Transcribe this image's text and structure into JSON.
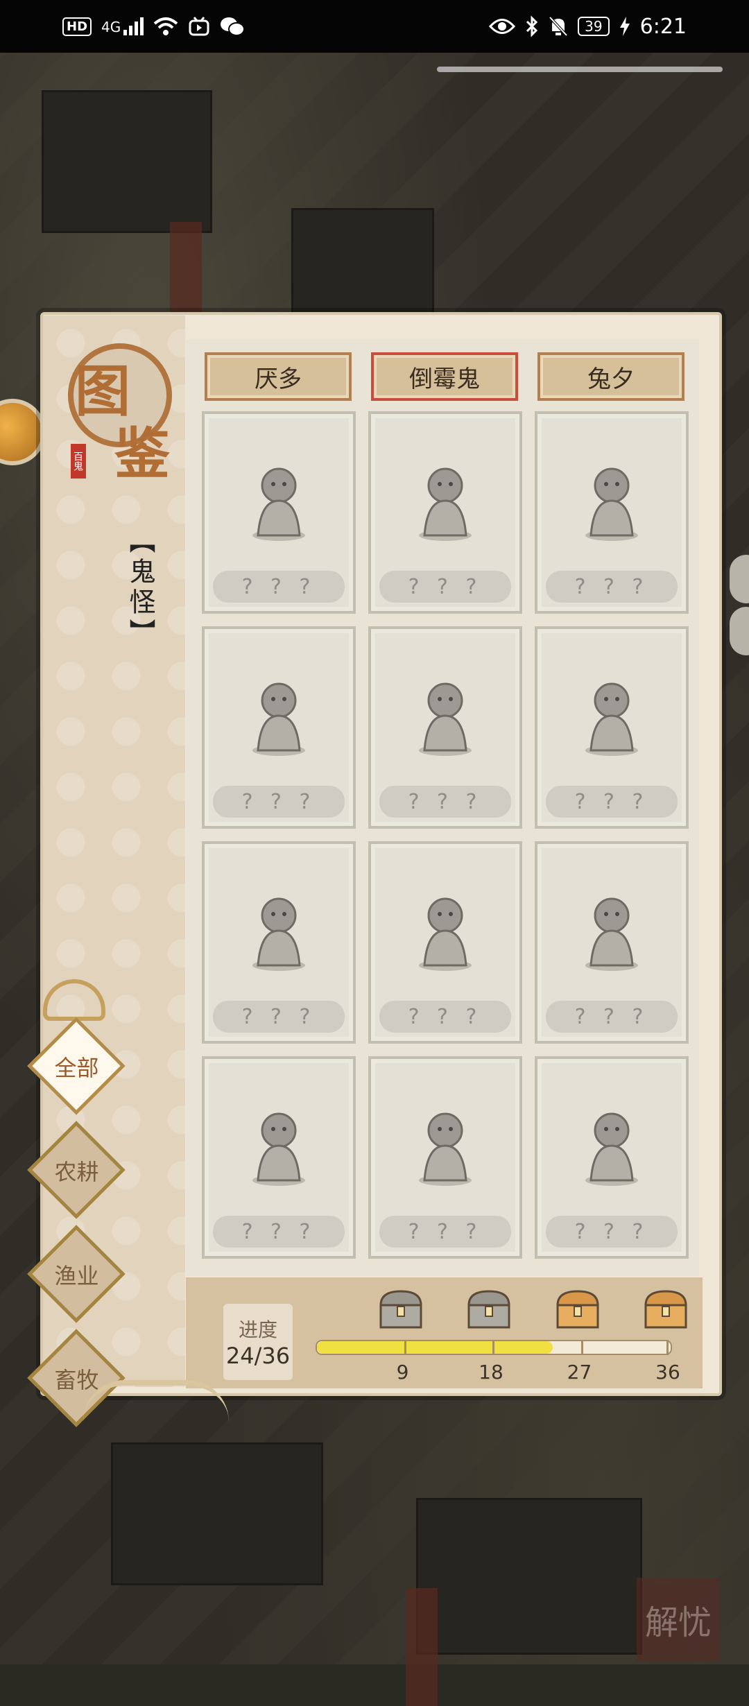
{
  "status_bar": {
    "left_icons": [
      "hd-icon",
      "4g-signal-icon",
      "wifi-icon",
      "bilibili-icon",
      "wechat-icon"
    ],
    "hd": "HD",
    "network": "4G",
    "battery": "39",
    "time": "6:21",
    "right_icons": [
      "eye-icon",
      "bluetooth-icon",
      "mute-bell-icon",
      "battery-icon",
      "charging-icon"
    ]
  },
  "panel": {
    "title_chars": [
      "图",
      "鉴"
    ],
    "seal_text": "百鬼",
    "category_label": "【鬼怪】"
  },
  "columns": [
    "厌多",
    "倒霉鬼",
    "兔夕"
  ],
  "cards": [
    {
      "label": "? ? ?",
      "icon": "ghost-with-horn-icon"
    },
    {
      "label": "? ? ?",
      "icon": "robed-ghost-with-lantern-icon"
    },
    {
      "label": "? ? ?",
      "icon": "teapot-spirit-icon"
    },
    {
      "label": "? ? ?",
      "icon": "lion-dance-head-icon"
    },
    {
      "label": "? ? ?",
      "icon": "coffin-ghost-icon"
    },
    {
      "label": "? ? ?",
      "icon": "fox-spirit-icon"
    },
    {
      "label": "? ? ?",
      "icon": "bird-staff-ghost-icon"
    },
    {
      "label": "? ? ?",
      "icon": "spear-warrior-ghost-icon"
    },
    {
      "label": "? ? ?",
      "icon": "straw-hat-farmer-ghost-icon"
    },
    {
      "label": "? ? ?",
      "icon": "hooded-official-ghost-icon"
    },
    {
      "label": "? ? ?",
      "icon": "dragon-rider-ghost-icon"
    },
    {
      "label": "? ? ?",
      "icon": "fortune-god-ghost-icon"
    }
  ],
  "progress": {
    "label": "进度",
    "value_text": "24/36",
    "current": 24,
    "max": 36,
    "milestones": [
      "9",
      "18",
      "27",
      "36"
    ],
    "chest_icons": [
      "silver-chest-icon",
      "silver-chest-icon",
      "gold-chest-icon",
      "gold-chest-icon"
    ]
  },
  "categories": [
    {
      "label": "全部",
      "active": true
    },
    {
      "label": "农耕",
      "active": false
    },
    {
      "label": "渔业",
      "active": false
    },
    {
      "label": "畜牧",
      "active": false
    }
  ],
  "corner_seal": "解忧",
  "colors": {
    "panel_bg": "#efe6d6",
    "accent": "#b06d34",
    "progress_fill": "#f0e040"
  }
}
